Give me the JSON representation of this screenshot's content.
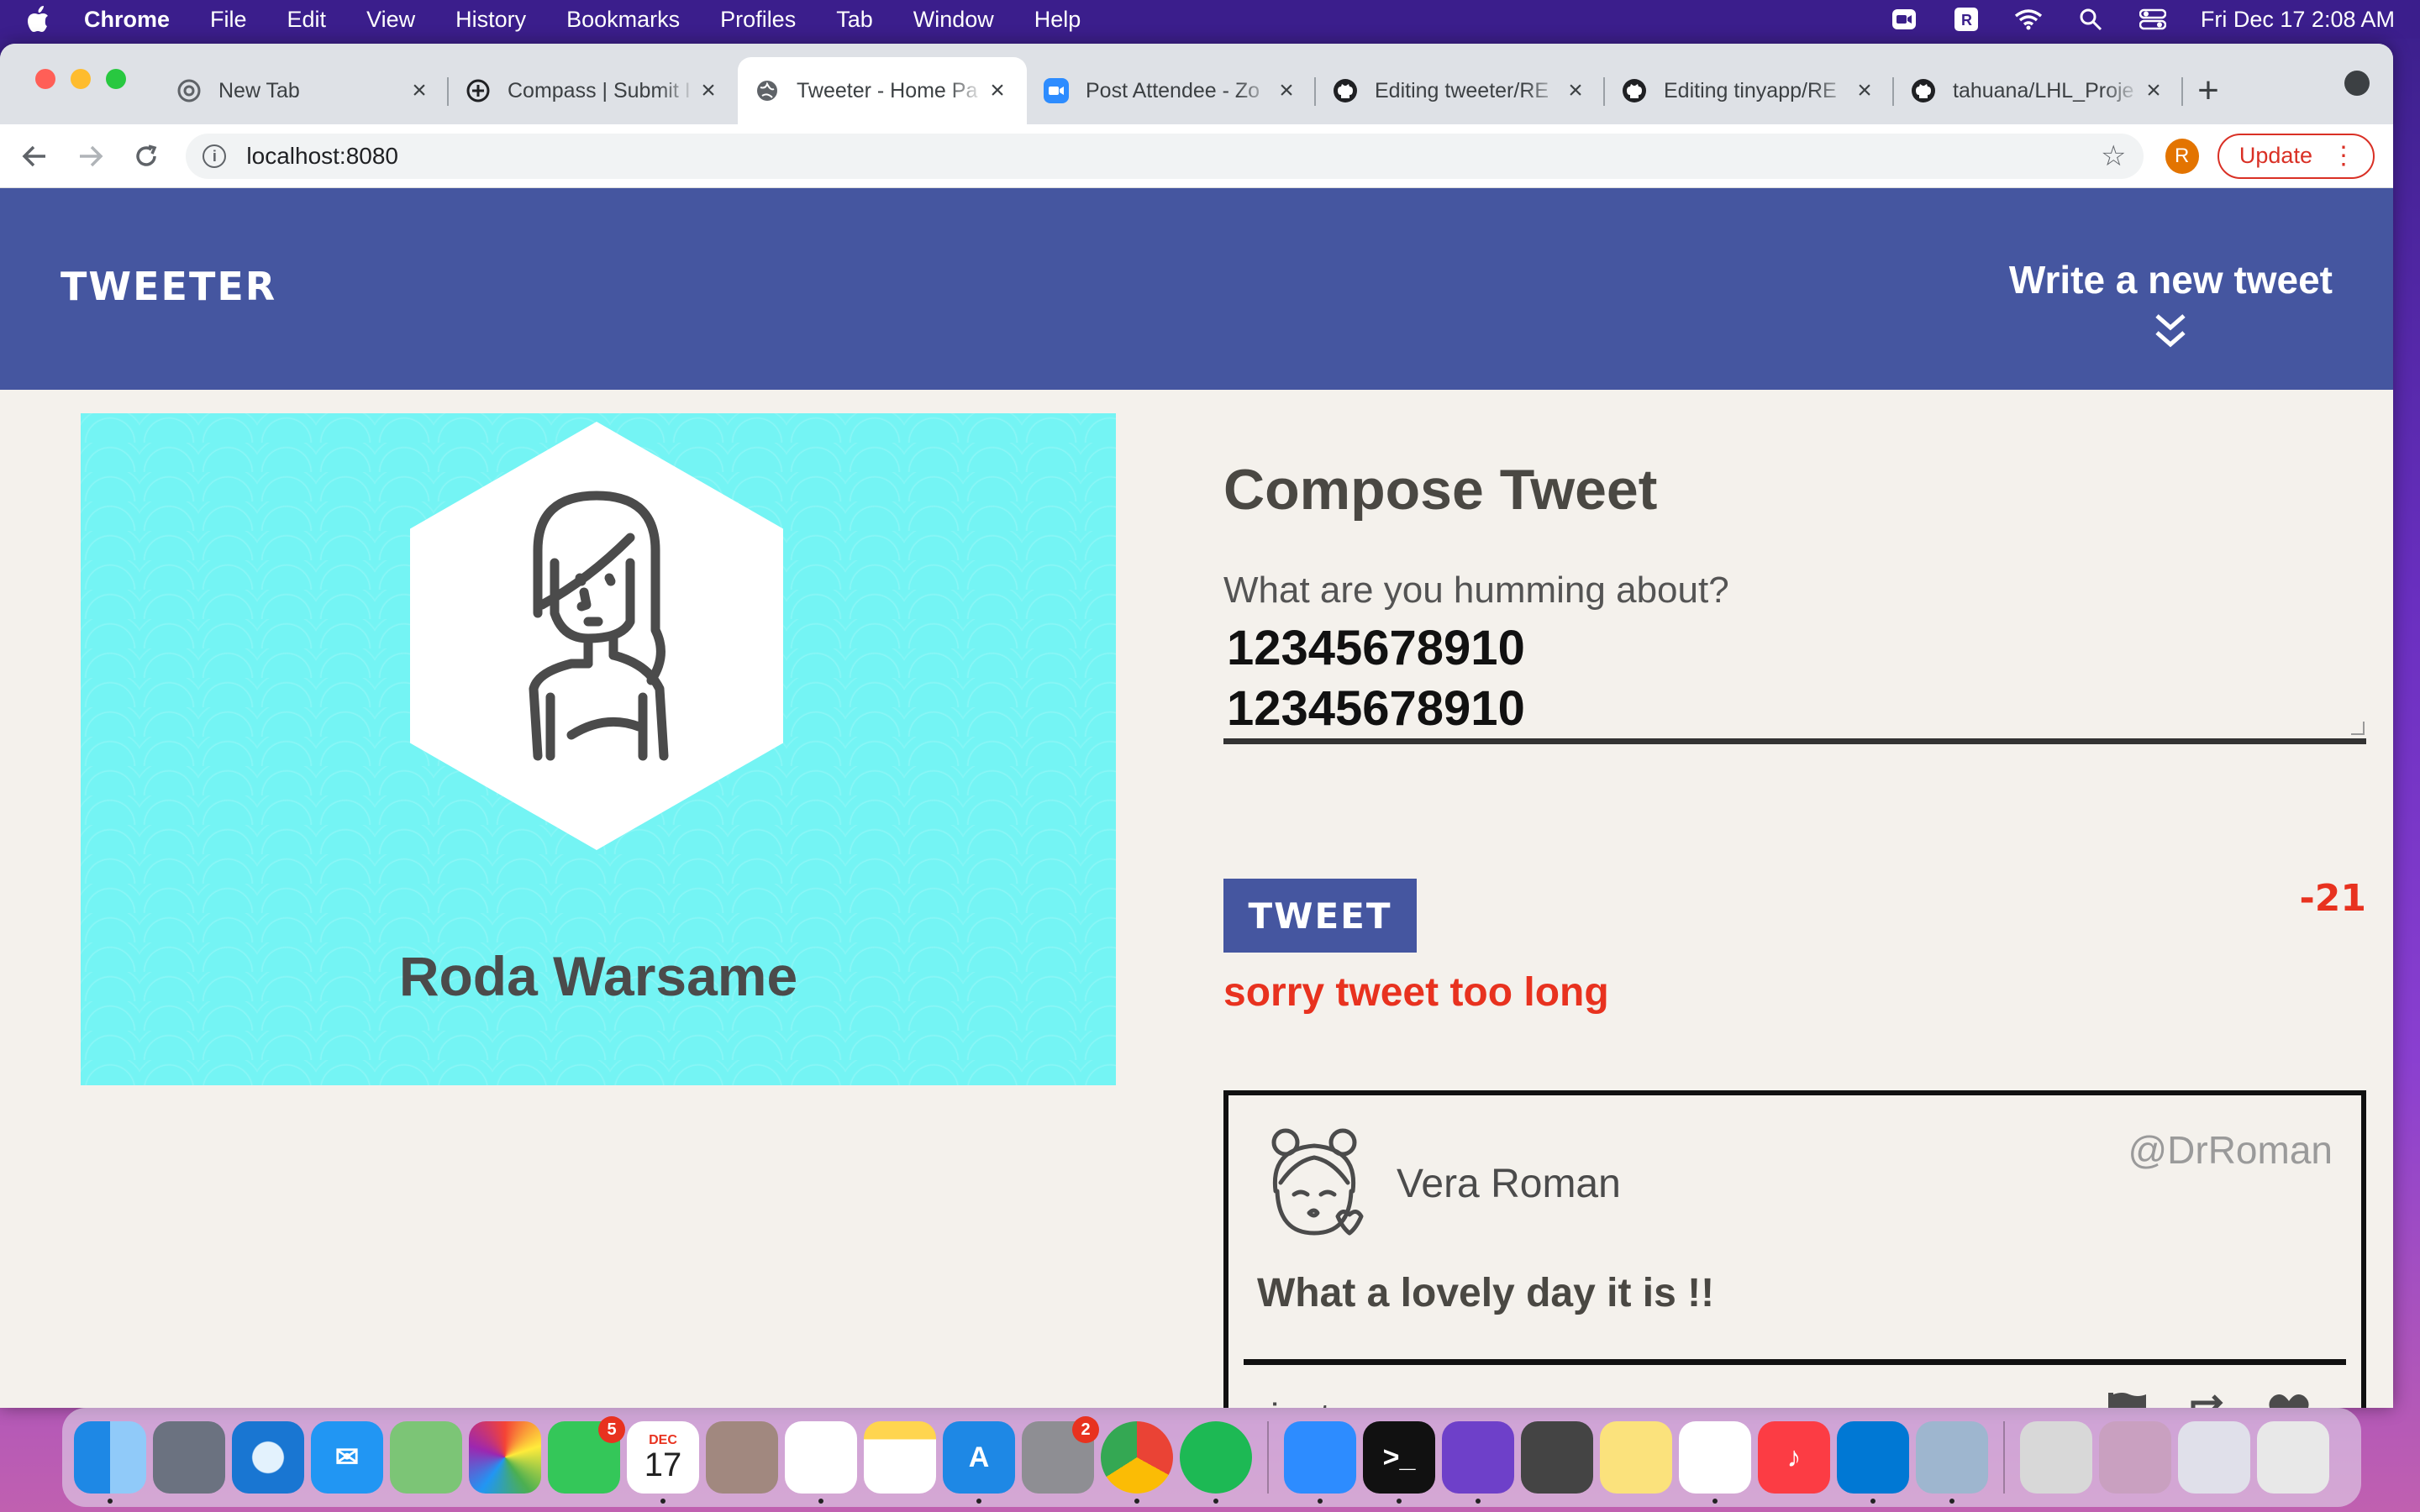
{
  "menubar": {
    "app": "Chrome",
    "items": [
      "File",
      "Edit",
      "View",
      "History",
      "Bookmarks",
      "Profiles",
      "Tab",
      "Window",
      "Help"
    ],
    "clock": "Fri Dec 17  2:08 AM"
  },
  "browser": {
    "tabs": [
      {
        "title": "New Tab",
        "icon": "chrome-icon"
      },
      {
        "title": "Compass | Submit I",
        "icon": "compass-icon"
      },
      {
        "title": "Tweeter - Home Pa",
        "icon": "globe-icon"
      },
      {
        "title": "Post Attendee - Zo",
        "icon": "zoom-icon"
      },
      {
        "title": "Editing tweeter/RE",
        "icon": "github-icon"
      },
      {
        "title": "Editing tinyapp/RE",
        "icon": "github-icon"
      },
      {
        "title": "tahuana/LHL_Proje",
        "icon": "github-icon"
      }
    ],
    "active_tab": 2,
    "url": "localhost:8080",
    "profile_initial": "R",
    "update_label": "Update"
  },
  "page": {
    "brand": "TWEETER",
    "write_new": "Write a new tweet",
    "profile_name": "Roda Warsame",
    "compose_title": "Compose Tweet",
    "prompt": "What are you humming about?",
    "text_line1": "12345678910",
    "text_line2": "12345678910",
    "tweet_button": "TWEET",
    "counter": "-21",
    "error": "sorry tweet too long"
  },
  "tweet": {
    "name": "Vera Roman",
    "handle": "@DrRoman",
    "content": "What a lovely day it is !!",
    "time": "just now"
  },
  "dock": {
    "facetime_badge": "5",
    "calendar_month": "DEC",
    "calendar_day": "17",
    "settings_badge": "2"
  },
  "colors": {
    "nav": "#4556a0",
    "profile_bg": "#74f4f4",
    "error": "#e8321f",
    "page_bg": "#f4f1ec"
  }
}
